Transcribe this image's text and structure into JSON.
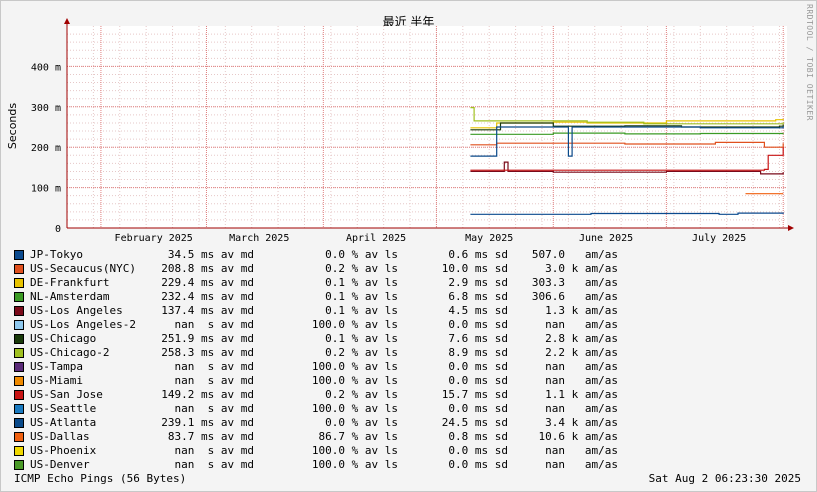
{
  "chart_data": {
    "type": "line",
    "title": "最近 半年",
    "ylabel": "Seconds",
    "ylim": [
      0,
      0.5
    ],
    "ytick_values": [
      0,
      0.1,
      0.2,
      0.3,
      0.4
    ],
    "ytick_labels": [
      "0",
      "100 m",
      "200 m",
      "300 m",
      "400 m"
    ],
    "xlim": [
      "2025-01-23",
      "2025-08-02"
    ],
    "xtick_labels": [
      {
        "label": "February 2025",
        "date": "2025-02-15"
      },
      {
        "label": "March 2025",
        "date": "2025-03-15"
      },
      {
        "label": "April 2025",
        "date": "2025-04-15"
      },
      {
        "label": "May 2025",
        "date": "2025-05-15"
      },
      {
        "label": "June 2025",
        "date": "2025-06-15"
      },
      {
        "label": "July 2025",
        "date": "2025-07-15"
      }
    ],
    "month_boundaries": [
      "2025-02-01",
      "2025-03-01",
      "2025-04-01",
      "2025-05-01",
      "2025-06-01",
      "2025-07-01",
      "2025-08-01"
    ],
    "grid": true,
    "series": [
      {
        "name": "JP-Tokyo",
        "color": "#0b4a8e",
        "points": [
          [
            "2025-05-10",
            0.034
          ],
          [
            "2025-06-10",
            0.034
          ],
          [
            "2025-06-11",
            0.036
          ],
          [
            "2025-07-15",
            0.034
          ],
          [
            "2025-07-20",
            0.037
          ],
          [
            "2025-08-01",
            0.035
          ]
        ]
      },
      {
        "name": "US-Secaucus(NYC)",
        "color": "#e0501e",
        "points": [
          [
            "2025-05-10",
            0.206
          ],
          [
            "2025-05-17",
            0.208
          ],
          [
            "2025-05-17",
            0.21
          ],
          [
            "2025-06-05",
            0.21
          ],
          [
            "2025-06-20",
            0.208
          ],
          [
            "2025-07-14",
            0.212
          ],
          [
            "2025-07-26",
            0.212
          ],
          [
            "2025-07-27",
            0.2
          ],
          [
            "2025-08-01",
            0.21
          ]
        ]
      },
      {
        "name": "DE-Frankfurt",
        "color": "#e8c300",
        "points": [
          [
            "2025-05-10",
            0.248
          ],
          [
            "2025-05-17",
            0.26
          ],
          [
            "2025-06-01",
            0.262
          ],
          [
            "2025-06-10",
            0.26
          ],
          [
            "2025-07-01",
            0.265
          ],
          [
            "2025-07-30",
            0.268
          ],
          [
            "2025-08-01",
            0.27
          ]
        ]
      },
      {
        "name": "NL-Amsterdam",
        "color": "#3b9a24",
        "points": [
          [
            "2025-05-10",
            0.232
          ],
          [
            "2025-05-16",
            0.232
          ],
          [
            "2025-06-01",
            0.235
          ],
          [
            "2025-06-20",
            0.233
          ],
          [
            "2025-07-10",
            0.234
          ],
          [
            "2025-08-01",
            0.235
          ]
        ]
      },
      {
        "name": "US-Los Angeles",
        "color": "#7a0a1a",
        "points": [
          [
            "2025-05-10",
            0.14
          ],
          [
            "2025-05-18",
            0.14
          ],
          [
            "2025-05-19",
            0.163
          ],
          [
            "2025-05-20",
            0.14
          ],
          [
            "2025-06-01",
            0.138
          ],
          [
            "2025-07-01",
            0.14
          ],
          [
            "2025-07-26",
            0.134
          ],
          [
            "2025-08-01",
            0.138
          ]
        ]
      },
      {
        "name": "US-Los Angeles-2",
        "color": "#8fc8ee",
        "points": []
      },
      {
        "name": "US-Chicago",
        "color": "#1a3a0a",
        "points": [
          [
            "2025-05-10",
            0.243
          ],
          [
            "2025-05-17",
            0.243
          ],
          [
            "2025-05-18",
            0.26
          ],
          [
            "2025-06-01",
            0.252
          ],
          [
            "2025-06-20",
            0.253
          ],
          [
            "2025-07-05",
            0.25
          ],
          [
            "2025-07-31",
            0.252
          ],
          [
            "2025-08-01",
            0.256
          ]
        ]
      },
      {
        "name": "US-Chicago-2",
        "color": "#a0c020",
        "points": [
          [
            "2025-05-10",
            0.298
          ],
          [
            "2025-05-11",
            0.265
          ],
          [
            "2025-05-30",
            0.265
          ],
          [
            "2025-06-10",
            0.262
          ],
          [
            "2025-06-25",
            0.258
          ],
          [
            "2025-07-15",
            0.258
          ],
          [
            "2025-08-01",
            0.262
          ]
        ]
      },
      {
        "name": "US-Tampa",
        "color": "#5a2a78",
        "points": []
      },
      {
        "name": "US-Miami",
        "color": "#f08a00",
        "points": []
      },
      {
        "name": "US-San Jose",
        "color": "#c81414",
        "points": [
          [
            "2025-05-10",
            0.143
          ],
          [
            "2025-07-20",
            0.143
          ],
          [
            "2025-07-27",
            0.145
          ],
          [
            "2025-07-28",
            0.18
          ],
          [
            "2025-08-01",
            0.2
          ]
        ]
      },
      {
        "name": "US-Seattle",
        "color": "#1a7ac0",
        "points": []
      },
      {
        "name": "US-Atlanta",
        "color": "#0a4a8a",
        "points": [
          [
            "2025-05-10",
            0.178
          ],
          [
            "2025-05-16",
            0.178
          ],
          [
            "2025-05-17",
            0.25
          ],
          [
            "2025-06-04",
            0.25
          ],
          [
            "2025-06-05",
            0.178
          ],
          [
            "2025-06-06",
            0.25
          ],
          [
            "2025-07-10",
            0.248
          ],
          [
            "2025-08-01",
            0.252
          ]
        ]
      },
      {
        "name": "US-Dallas",
        "color": "#f06010",
        "points": [
          [
            "2025-07-22",
            0.085
          ],
          [
            "2025-08-01",
            0.085
          ]
        ]
      },
      {
        "name": "US-Phoenix",
        "color": "#f0d800",
        "points": []
      },
      {
        "name": "US-Denver",
        "color": "#4a9a28",
        "points": []
      }
    ]
  },
  "legend": [
    {
      "name": "JP-Tokyo",
      "color": "#0b4a8e",
      "avg": "34.5 ms av md",
      "loss": "0.0 % av ls",
      "sd": "0.6 ms sd",
      "amas": "507.0   am/as"
    },
    {
      "name": "US-Secaucus(NYC)",
      "color": "#e0501e",
      "avg": "208.8 ms av md",
      "loss": "0.2 % av ls",
      "sd": "10.0 ms sd",
      "amas": "3.0 k am/as"
    },
    {
      "name": "DE-Frankfurt",
      "color": "#e8c300",
      "avg": "229.4 ms av md",
      "loss": "0.1 % av ls",
      "sd": "2.9 ms sd",
      "amas": "303.3   am/as"
    },
    {
      "name": "NL-Amsterdam",
      "color": "#3b9a24",
      "avg": "232.4 ms av md",
      "loss": "0.1 % av ls",
      "sd": "6.8 ms sd",
      "amas": "306.6   am/as"
    },
    {
      "name": "US-Los Angeles",
      "color": "#7a0a1a",
      "avg": "137.4 ms av md",
      "loss": "0.1 % av ls",
      "sd": "4.5 ms sd",
      "amas": "1.3 k am/as"
    },
    {
      "name": "US-Los Angeles-2",
      "color": "#8fc8ee",
      "avg": "nan  s av md",
      "loss": "100.0 % av ls",
      "sd": "0.0 ms sd",
      "amas": "nan   am/as"
    },
    {
      "name": "US-Chicago",
      "color": "#1a3a0a",
      "avg": "251.9 ms av md",
      "loss": "0.1 % av ls",
      "sd": "7.6 ms sd",
      "amas": "2.8 k am/as"
    },
    {
      "name": "US-Chicago-2",
      "color": "#a0c020",
      "avg": "258.3 ms av md",
      "loss": "0.2 % av ls",
      "sd": "8.9 ms sd",
      "amas": "2.2 k am/as"
    },
    {
      "name": "US-Tampa",
      "color": "#5a2a78",
      "avg": "nan  s av md",
      "loss": "100.0 % av ls",
      "sd": "0.0 ms sd",
      "amas": "nan   am/as"
    },
    {
      "name": "US-Miami",
      "color": "#f08a00",
      "avg": "nan  s av md",
      "loss": "100.0 % av ls",
      "sd": "0.0 ms sd",
      "amas": "nan   am/as"
    },
    {
      "name": "US-San Jose",
      "color": "#c81414",
      "avg": "149.2 ms av md",
      "loss": "0.2 % av ls",
      "sd": "15.7 ms sd",
      "amas": "1.1 k am/as"
    },
    {
      "name": "US-Seattle",
      "color": "#1a7ac0",
      "avg": "nan  s av md",
      "loss": "100.0 % av ls",
      "sd": "0.0 ms sd",
      "amas": "nan   am/as"
    },
    {
      "name": "US-Atlanta",
      "color": "#0a4a8a",
      "avg": "239.1 ms av md",
      "loss": "0.0 % av ls",
      "sd": "24.5 ms sd",
      "amas": "3.4 k am/as"
    },
    {
      "name": "US-Dallas",
      "color": "#f06010",
      "avg": "83.7 ms av md",
      "loss": "86.7 % av ls",
      "sd": "0.8 ms sd",
      "amas": "10.6 k am/as"
    },
    {
      "name": "US-Phoenix",
      "color": "#f0d800",
      "avg": "nan  s av md",
      "loss": "100.0 % av ls",
      "sd": "0.0 ms sd",
      "amas": "nan   am/as"
    },
    {
      "name": "US-Denver",
      "color": "#4a9a28",
      "avg": "nan  s av md",
      "loss": "100.0 % av ls",
      "sd": "0.0 ms sd",
      "amas": "nan   am/as"
    }
  ],
  "footer": {
    "left": "ICMP Echo Pings (56 Bytes)",
    "right": "Sat Aug  2 06:23:30 2025"
  },
  "watermark": "RRDTOOL / TOBI OETIKER",
  "colors": {
    "background": "#f4f4f4",
    "plot_bg": "#ffffff",
    "grid_minor": "#e6c8c8",
    "grid_major": "#e08080",
    "axis": "#a00000"
  }
}
